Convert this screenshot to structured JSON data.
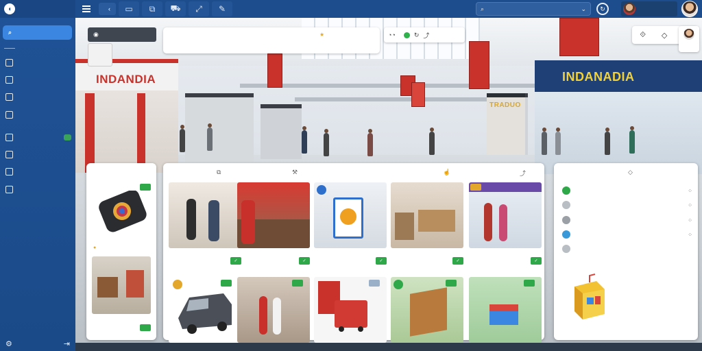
{
  "topbar": {
    "app_name": "",
    "nav_pill_label": "",
    "search_placeholder": "",
    "user_name": ""
  },
  "sidebar": {
    "active_item": "",
    "section_label": "",
    "items": [
      {
        "label": "",
        "icon": "home-icon"
      },
      {
        "label": "",
        "icon": "image-icon"
      },
      {
        "label": "",
        "icon": "store-icon"
      },
      {
        "label": "",
        "icon": "chart-icon"
      },
      {
        "label": "",
        "icon": "layers-icon",
        "badge": true
      },
      {
        "label": "",
        "icon": "bag-icon"
      },
      {
        "label": "",
        "icon": "box-icon"
      },
      {
        "label": "",
        "icon": "grid-icon"
      }
    ]
  },
  "overlays": {
    "dark_chip_label": "",
    "title_card": {
      "title": "",
      "subtitle": "",
      "right_label": ""
    },
    "tools_label": "",
    "profile_label": ""
  },
  "scene_signs": {
    "left_store": "INDANDIA",
    "right_store": "INDANADIA",
    "center_store": "TRADUO"
  },
  "featured_panel": {
    "title": "",
    "item_name": "",
    "item_sub": "",
    "item2_name": ""
  },
  "catalog_panel": {
    "title": "",
    "tab": "",
    "filter": "",
    "products": [
      {
        "name": "",
        "sub": ""
      },
      {
        "name": "",
        "sub": ""
      },
      {
        "name": "",
        "sub": ""
      },
      {
        "name": "",
        "sub": ""
      },
      {
        "name": "",
        "sub": ""
      },
      {
        "name": "",
        "sub": ""
      },
      {
        "name": "",
        "sub": ""
      },
      {
        "name": "",
        "sub": ""
      },
      {
        "name": "",
        "sub": ""
      },
      {
        "name": "",
        "sub": ""
      }
    ]
  },
  "recommend_panel": {
    "title": "",
    "items": [
      {
        "label": "",
        "color": "#2fa84a"
      },
      {
        "label": "",
        "color": "#b9bec4"
      },
      {
        "label": "",
        "color": "#9aa0a6"
      },
      {
        "label": "",
        "color": "#3a9ad9"
      },
      {
        "label": "",
        "color": "#b9bec4"
      }
    ]
  },
  "bottombar": {
    "left": "",
    "right": ""
  },
  "colors": {
    "primary": "#1d4d8c",
    "accent": "#3a86e0",
    "success": "#2fa84a",
    "sign_red": "#c8322b"
  }
}
